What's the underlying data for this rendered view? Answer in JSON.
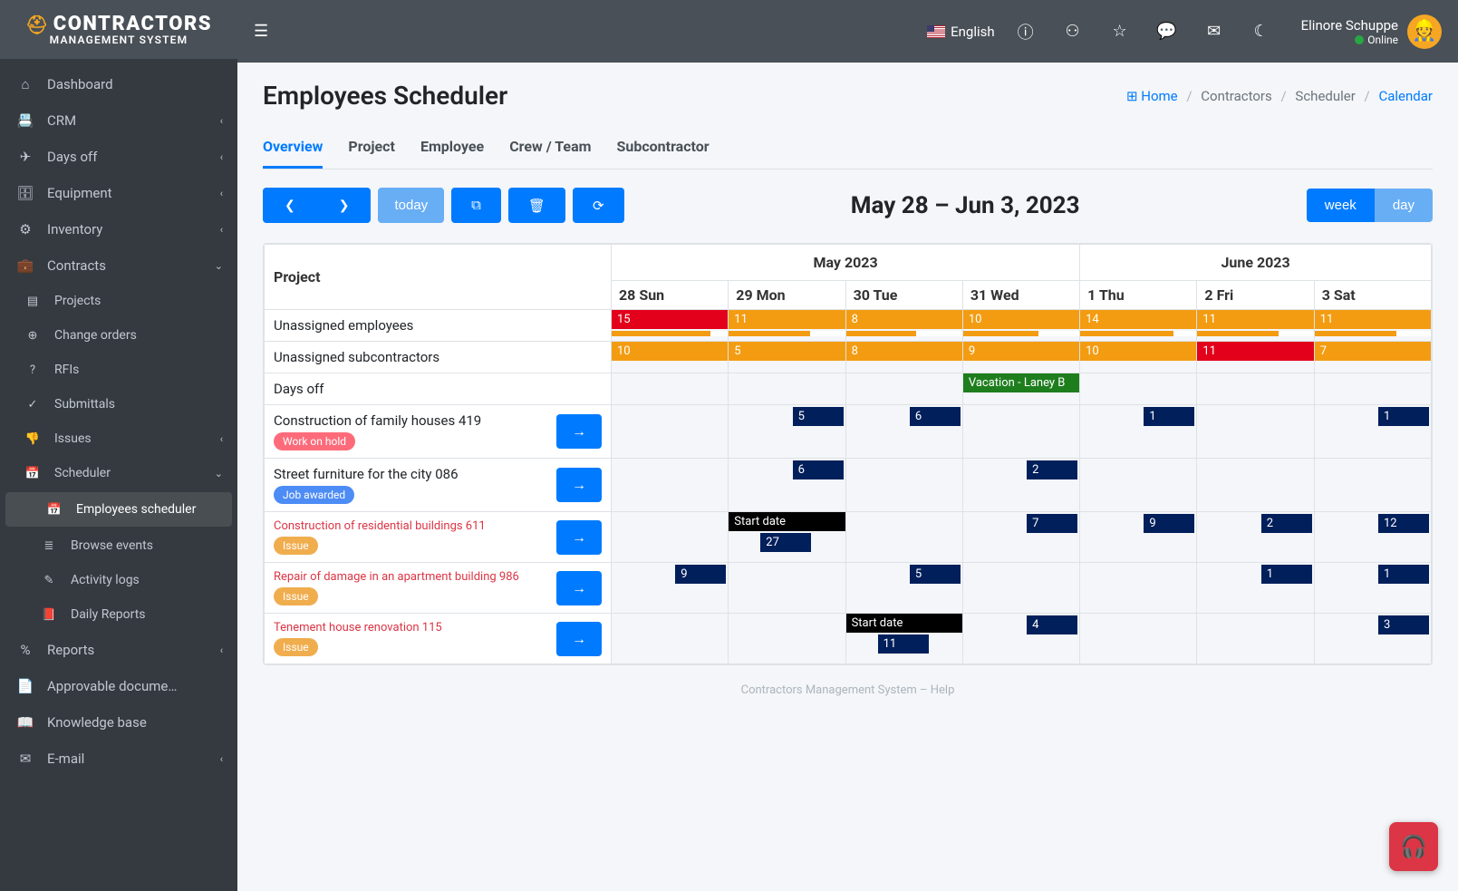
{
  "logo": {
    "line1": "CONTRACTORS",
    "line2": "MANAGEMENT SYSTEM"
  },
  "sidebar": {
    "items": [
      {
        "label": "Dashboard",
        "icon": "⌂"
      },
      {
        "label": "CRM",
        "icon": "📇",
        "chev": true
      },
      {
        "label": "Days off",
        "icon": "✈",
        "chev": true
      },
      {
        "label": "Equipment",
        "icon": "🗄",
        "chev": true
      },
      {
        "label": "Inventory",
        "icon": "⚙",
        "chev": true
      },
      {
        "label": "Contracts",
        "icon": "💼",
        "chev": true,
        "expanded": true,
        "children": [
          {
            "label": "Projects",
            "icon": "▤"
          },
          {
            "label": "Change orders",
            "icon": "⊕"
          },
          {
            "label": "RFIs",
            "icon": "?"
          },
          {
            "label": "Submittals",
            "icon": "✓"
          },
          {
            "label": "Issues",
            "icon": "👎",
            "chev": true
          },
          {
            "label": "Scheduler",
            "icon": "📅",
            "chev": true,
            "expanded": true,
            "children": [
              {
                "label": "Employees scheduler",
                "icon": "📅",
                "active": true
              },
              {
                "label": "Browse events",
                "icon": "≣"
              },
              {
                "label": "Activity logs",
                "icon": "✎"
              },
              {
                "label": "Daily Reports",
                "icon": "📕"
              }
            ]
          }
        ]
      },
      {
        "label": "Reports",
        "icon": "%",
        "chev": true
      },
      {
        "label": "Approvable docume…",
        "icon": "📄"
      },
      {
        "label": "Knowledge base",
        "icon": "📖"
      },
      {
        "label": "E-mail",
        "icon": "✉",
        "chev": true
      }
    ]
  },
  "topbar": {
    "language": "English",
    "user_name": "Elinore Schuppe",
    "user_status": "Online"
  },
  "header": {
    "title": "Employees Scheduler",
    "breadcrumb": {
      "home": "Home",
      "b1": "Contractors",
      "b2": "Scheduler",
      "current": "Calendar"
    }
  },
  "tabs": [
    "Overview",
    "Project",
    "Employee",
    "Crew / Team",
    "Subcontractor"
  ],
  "toolbar": {
    "today": "today",
    "title": "May 28 – Jun 3, 2023",
    "week": "week",
    "day": "day"
  },
  "calendar": {
    "project_header": "Project",
    "months": [
      "May 2023",
      "June 2023"
    ],
    "days": [
      "28 Sun",
      "29 Mon",
      "30 Tue",
      "31 Wed",
      "1 Thu",
      "2 Fri",
      "3 Sat"
    ],
    "rows": [
      {
        "label": "Unassigned employees",
        "type": "bar",
        "cells": [
          {
            "val": "15",
            "color": "red",
            "gauge": 85
          },
          {
            "val": "11",
            "color": "orange",
            "gauge": 70
          },
          {
            "val": "8",
            "color": "orange",
            "gauge": 60
          },
          {
            "val": "10",
            "color": "orange",
            "gauge": 65
          },
          {
            "val": "14",
            "color": "orange",
            "gauge": 80
          },
          {
            "val": "11",
            "color": "orange",
            "gauge": 70
          },
          {
            "val": "11",
            "color": "orange",
            "gauge": 70
          }
        ]
      },
      {
        "label": "Unassigned subcontractors",
        "type": "bar",
        "cells": [
          {
            "val": "10",
            "color": "orange"
          },
          {
            "val": "5",
            "color": "orange"
          },
          {
            "val": "8",
            "color": "orange"
          },
          {
            "val": "9",
            "color": "orange"
          },
          {
            "val": "10",
            "color": "orange"
          },
          {
            "val": "11",
            "color": "red"
          },
          {
            "val": "7",
            "color": "orange"
          }
        ]
      },
      {
        "label": "Days off",
        "type": "event",
        "cells": [
          null,
          null,
          null,
          {
            "text": "Vacation - Laney B",
            "color": "green",
            "span": 1
          },
          null,
          null,
          null
        ]
      },
      {
        "label": "Construction of family houses 419",
        "badge": "Work on hold",
        "badge_color": "red",
        "arrow": true,
        "type": "block",
        "cells": [
          null,
          {
            "val": "5"
          },
          {
            "val": "6"
          },
          null,
          {
            "val": "1"
          },
          null,
          {
            "val": "1"
          }
        ]
      },
      {
        "label": "Street furniture for the city 086",
        "badge": "Job awarded",
        "badge_color": "blue",
        "arrow": true,
        "type": "block",
        "cells": [
          null,
          {
            "val": "6"
          },
          null,
          {
            "val": "2"
          },
          null,
          null,
          null
        ]
      },
      {
        "label": "Construction of residential buildings 611",
        "issue": true,
        "badge": "Issue",
        "badge_color": "orange",
        "arrow": true,
        "type": "block",
        "cells": [
          null,
          {
            "start": "Start date",
            "val": "27"
          },
          null,
          {
            "val": "7"
          },
          {
            "val": "9"
          },
          {
            "val": "2"
          },
          {
            "val": "12"
          }
        ]
      },
      {
        "label": "Repair of damage in an apartment building 986",
        "issue": true,
        "badge": "Issue",
        "badge_color": "orange",
        "arrow": true,
        "type": "block",
        "cells": [
          {
            "val": "9"
          },
          null,
          {
            "val": "5"
          },
          null,
          null,
          {
            "val": "1"
          },
          {
            "val": "1"
          }
        ]
      },
      {
        "label": "Tenement house renovation 115",
        "issue": true,
        "badge": "Issue",
        "badge_color": "orange",
        "arrow": true,
        "type": "block",
        "cells": [
          null,
          null,
          {
            "start": "Start date",
            "val": "11"
          },
          {
            "val": "4"
          },
          null,
          null,
          {
            "val": "3"
          }
        ]
      }
    ]
  },
  "footer": "Contractors Management System – Help"
}
